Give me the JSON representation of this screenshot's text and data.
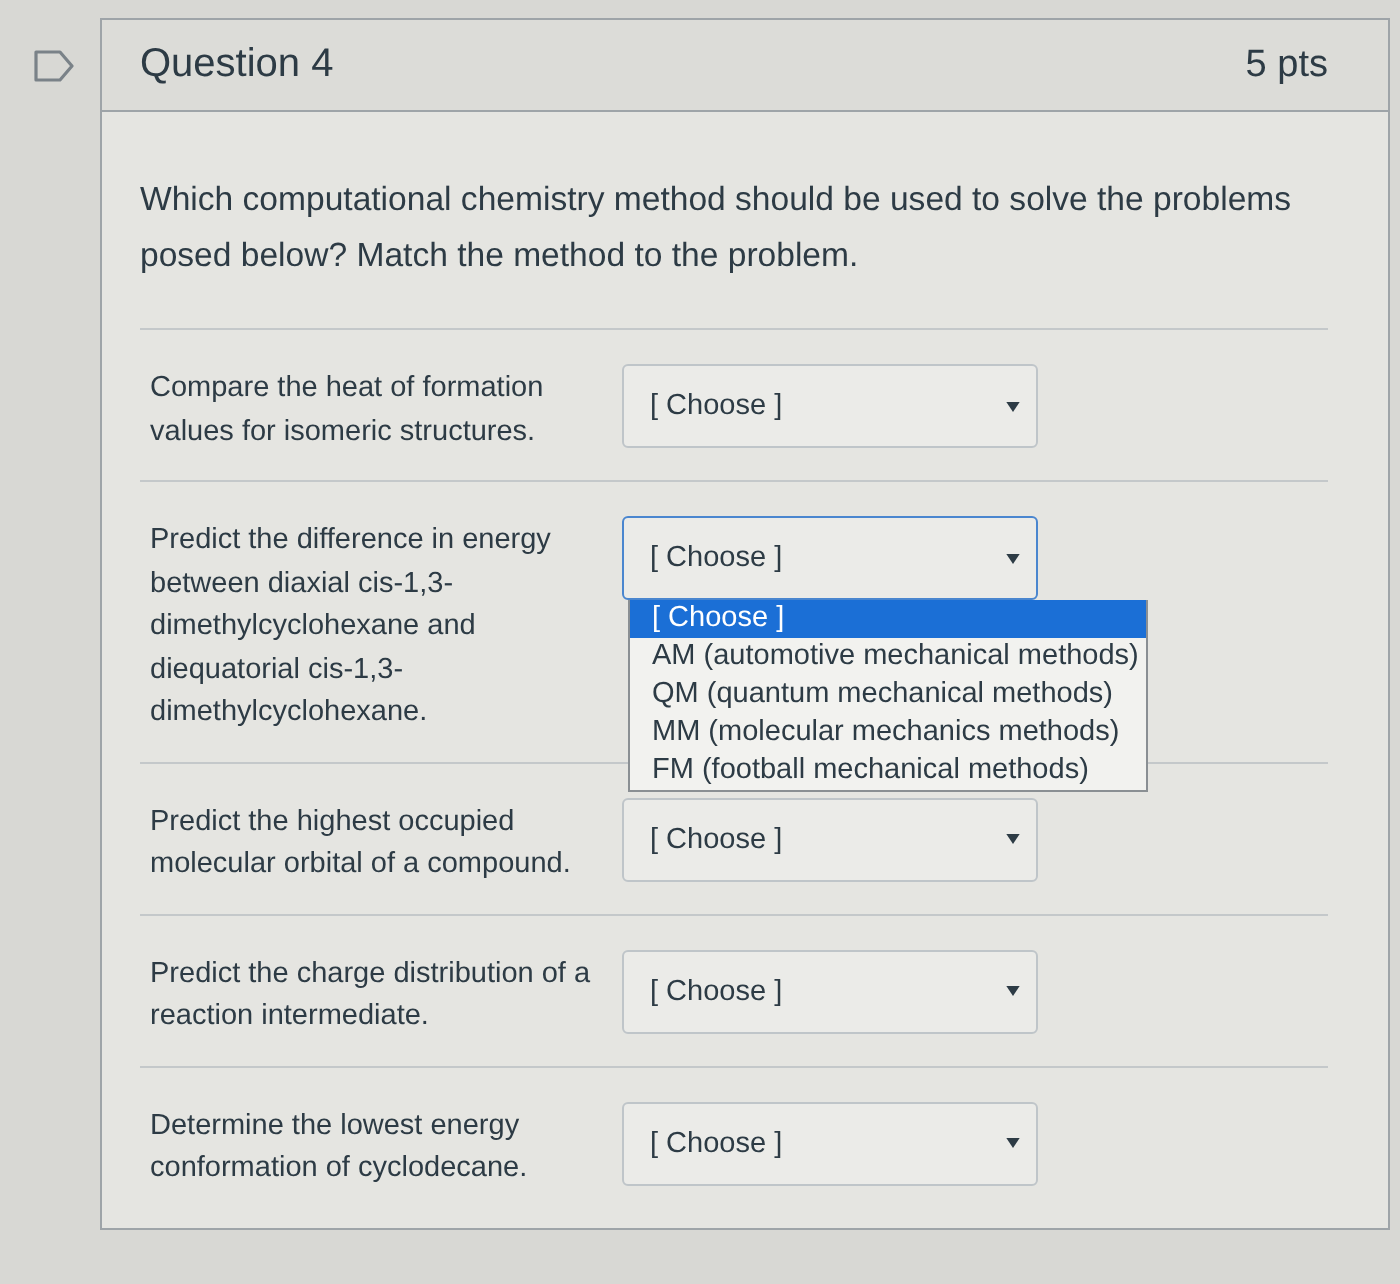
{
  "question": {
    "title": "Question 4",
    "points": "5 pts",
    "prompt": "Which computational chemistry method should be used to solve the problems posed below? Match the method to the problem."
  },
  "matches": [
    {
      "prompt": "Compare the heat of formation values for isomeric structures.",
      "select": {
        "value": "[ Choose ]",
        "expanded": false
      }
    },
    {
      "prompt": "Predict the difference in energy between diaxial cis-1,3-dimethylcyclohexane and diequatorial cis-1,3-dimethylcyclohexane.",
      "select": {
        "value": "[ Choose ]",
        "expanded": true,
        "options": [
          {
            "label": "[ Choose ]",
            "selected": true
          },
          {
            "label": "AM (automotive mechanical methods)",
            "selected": false
          },
          {
            "label": "QM (quantum mechanical methods)",
            "selected": false
          },
          {
            "label": "MM (molecular mechanics methods)",
            "selected": false
          },
          {
            "label": "FM (football mechanical methods)",
            "selected": false
          }
        ]
      }
    },
    {
      "prompt": "Predict the highest occupied molecular orbital of a compound.",
      "select": {
        "value": "[ Choose ]",
        "expanded": false
      }
    },
    {
      "prompt": "Predict the charge distribution of a reaction intermediate.",
      "select": {
        "value": "[ Choose ]",
        "expanded": false
      }
    },
    {
      "prompt": "Determine the lowest energy conformation of cyclodecane.",
      "select": {
        "value": "[ Choose ]",
        "expanded": false
      }
    }
  ]
}
